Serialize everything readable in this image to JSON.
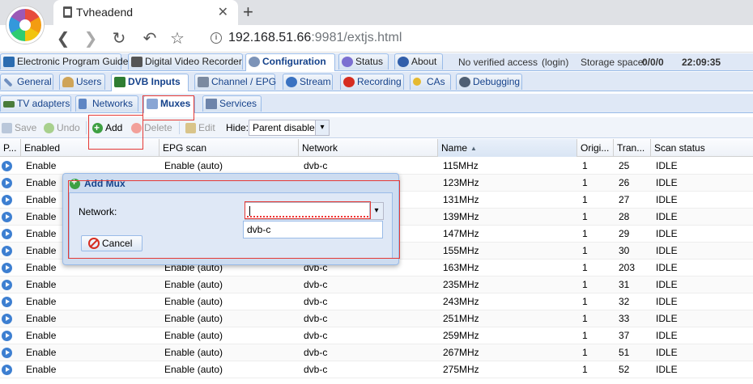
{
  "browser": {
    "tab_title": "Tvheadend",
    "close_glyph": "✕",
    "new_tab_glyph": "+",
    "back_glyph": "❮",
    "forward_glyph": "❯",
    "reload_glyph": "↻",
    "undo_glyph": "↶",
    "star_glyph": "☆",
    "url_host": "192.168.51.66",
    "url_rest": ":9981/extjs.html",
    "info_glyph": "i"
  },
  "main_tabs": [
    {
      "label": "Electronic Program Guide",
      "icon": "epg-icon"
    },
    {
      "label": "Digital Video Recorder",
      "icon": "dvr-icon"
    },
    {
      "label": "Configuration",
      "icon": "gear-icon",
      "active": true
    },
    {
      "label": "Status",
      "icon": "eye-icon"
    },
    {
      "label": "About",
      "icon": "info-icon"
    }
  ],
  "status_bar": {
    "access": "No verified access",
    "login": "(login)",
    "storage_label": "Storage space:",
    "storage_value": "0/0/0",
    "clock": "22:09:35"
  },
  "config_tabs": [
    {
      "label": "General"
    },
    {
      "label": "Users"
    },
    {
      "label": "DVB Inputs",
      "active": true
    },
    {
      "label": "Channel / EPG"
    },
    {
      "label": "Stream"
    },
    {
      "label": "Recording"
    },
    {
      "label": "CAs"
    },
    {
      "label": "Debugging"
    }
  ],
  "dvb_tabs": [
    {
      "label": "TV adapters"
    },
    {
      "label": "Networks"
    },
    {
      "label": "Muxes",
      "active": true
    },
    {
      "label": "Services"
    }
  ],
  "toolbar": {
    "save": "Save",
    "undo": "Undo",
    "add": "Add",
    "delete": "Delete",
    "edit": "Edit",
    "hide_label": "Hide:",
    "hide_value": "Parent disabled",
    "dropdown_glyph": "▾"
  },
  "grid": {
    "columns": [
      "P...",
      "Enabled",
      "EPG scan",
      "Network",
      "Name",
      "Origi...",
      "Tran...",
      "Scan status"
    ],
    "sorted_column": "Name",
    "rows": [
      {
        "enabled": "Enable",
        "epg": "Enable (auto)",
        "network": "dvb-c",
        "name": "115MHz",
        "orig": "1",
        "tran": "25",
        "scan": "IDLE"
      },
      {
        "enabled": "Enable",
        "epg": "",
        "network": "",
        "name": "123MHz",
        "orig": "1",
        "tran": "26",
        "scan": "IDLE"
      },
      {
        "enabled": "Enable",
        "epg": "",
        "network": "",
        "name": "131MHz",
        "orig": "1",
        "tran": "27",
        "scan": "IDLE"
      },
      {
        "enabled": "Enable",
        "epg": "",
        "network": "",
        "name": "139MHz",
        "orig": "1",
        "tran": "28",
        "scan": "IDLE"
      },
      {
        "enabled": "Enable",
        "epg": "",
        "network": "",
        "name": "147MHz",
        "orig": "1",
        "tran": "29",
        "scan": "IDLE"
      },
      {
        "enabled": "Enable",
        "epg": "",
        "network": "",
        "name": "155MHz",
        "orig": "1",
        "tran": "30",
        "scan": "IDLE"
      },
      {
        "enabled": "Enable",
        "epg": "Enable (auto)",
        "network": "dvb-c",
        "name": "163MHz",
        "orig": "1",
        "tran": "203",
        "scan": "IDLE"
      },
      {
        "enabled": "Enable",
        "epg": "Enable (auto)",
        "network": "dvb-c",
        "name": "235MHz",
        "orig": "1",
        "tran": "31",
        "scan": "IDLE"
      },
      {
        "enabled": "Enable",
        "epg": "Enable (auto)",
        "network": "dvb-c",
        "name": "243MHz",
        "orig": "1",
        "tran": "32",
        "scan": "IDLE"
      },
      {
        "enabled": "Enable",
        "epg": "Enable (auto)",
        "network": "dvb-c",
        "name": "251MHz",
        "orig": "1",
        "tran": "33",
        "scan": "IDLE"
      },
      {
        "enabled": "Enable",
        "epg": "Enable (auto)",
        "network": "dvb-c",
        "name": "259MHz",
        "orig": "1",
        "tran": "37",
        "scan": "IDLE"
      },
      {
        "enabled": "Enable",
        "epg": "Enable (auto)",
        "network": "dvb-c",
        "name": "267MHz",
        "orig": "1",
        "tran": "51",
        "scan": "IDLE"
      },
      {
        "enabled": "Enable",
        "epg": "Enable (auto)",
        "network": "dvb-c",
        "name": "275MHz",
        "orig": "1",
        "tran": "52",
        "scan": "IDLE"
      }
    ]
  },
  "dialog": {
    "title": "Add Mux",
    "network_label": "Network:",
    "network_value": "",
    "options": [
      "dvb-c"
    ],
    "cancel": "Cancel"
  },
  "colors": {
    "header_blue": "#15428b",
    "tab_background": "#dfe8f6",
    "annotation_red": "#e53935"
  }
}
